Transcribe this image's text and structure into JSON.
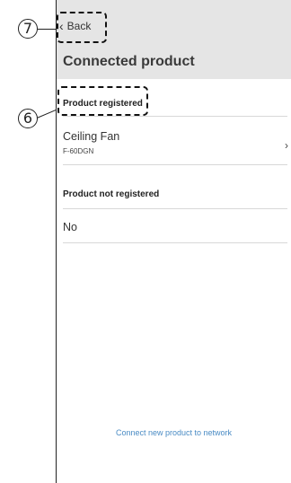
{
  "callouts": {
    "back": "7",
    "product_registered": "6"
  },
  "header": {
    "back_label": "Back",
    "title": "Connected product"
  },
  "registered": {
    "section_label": "Product registered",
    "items": [
      {
        "name": "Ceiling Fan",
        "model": "F-60DGN"
      }
    ]
  },
  "not_registered": {
    "section_label": "Product not registered",
    "value": "No"
  },
  "footer": {
    "connect_label": "Connect new product to network"
  },
  "colors": {
    "header_bg": "#e5e5e5",
    "link": "#4a8bc4"
  }
}
